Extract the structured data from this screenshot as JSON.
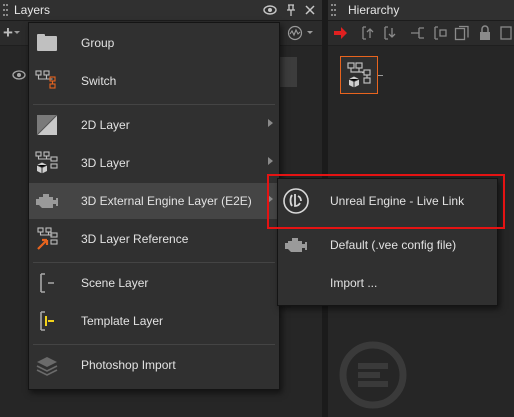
{
  "layers_panel": {
    "title": "Layers",
    "toolbar": {
      "add_label": "+"
    }
  },
  "hierarchy_panel": {
    "title": "Hierarchy"
  },
  "layer_menu": {
    "items": [
      {
        "label": "Group",
        "icon": "group-icon"
      },
      {
        "label": "Switch",
        "icon": "switch-icon"
      },
      {
        "label": "2D Layer",
        "icon": "2d-layer-icon",
        "has_submenu": true
      },
      {
        "label": "3D Layer",
        "icon": "3d-layer-icon",
        "has_submenu": true
      },
      {
        "label": "3D External Engine Layer (E2E)",
        "icon": "engine-icon",
        "has_submenu": true,
        "highlighted": true
      },
      {
        "label": "3D Layer Reference",
        "icon": "3d-layer-reference-icon"
      },
      {
        "label": "Scene Layer",
        "icon": "scene-layer-icon"
      },
      {
        "label": "Template Layer",
        "icon": "template-layer-icon"
      },
      {
        "label": "Photoshop Import",
        "icon": "photoshop-import-icon"
      }
    ]
  },
  "e2e_submenu": {
    "items": [
      {
        "label": "Unreal Engine - Live Link",
        "icon": "unreal-engine-icon"
      },
      {
        "label": "Default (.vee config file)",
        "icon": "engine-icon"
      },
      {
        "label": "Import ..."
      }
    ]
  },
  "colors": {
    "highlight_outline": "#e51313",
    "accent_orange": "#e8641e",
    "accent_red": "#e02020",
    "accent_yellow": "#f2d21a"
  }
}
